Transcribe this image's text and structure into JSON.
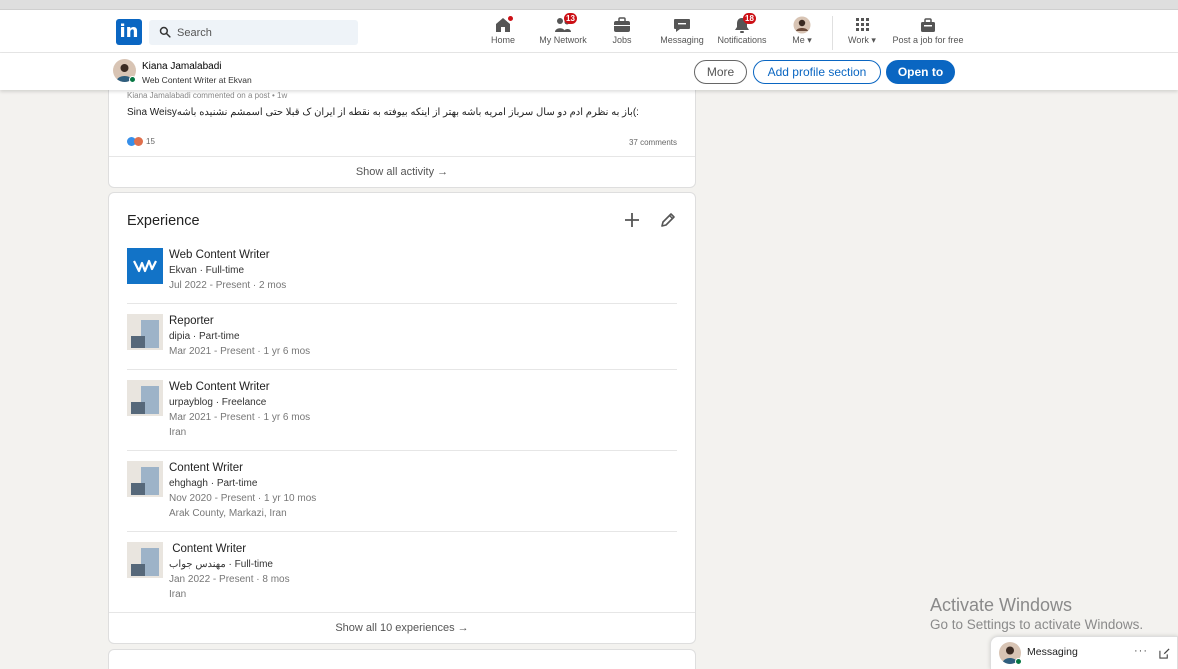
{
  "nav": {
    "search_placeholder": "Search",
    "items": [
      {
        "label": "Home",
        "icon": "home-icon",
        "badge": ""
      },
      {
        "label": "My Network",
        "icon": "people-icon",
        "badge": "13"
      },
      {
        "label": "Jobs",
        "icon": "briefcase-icon",
        "badge": ""
      },
      {
        "label": "Messaging",
        "icon": "chat-icon",
        "badge": ""
      },
      {
        "label": "Notifications",
        "icon": "bell-icon",
        "badge": "18"
      },
      {
        "label": "Me",
        "icon": "avatar",
        "badge": ""
      },
      {
        "label": "Work",
        "icon": "grid-icon",
        "badge": ""
      },
      {
        "label": "Post a job for free",
        "icon": "briefcase-plus-icon",
        "badge": ""
      }
    ],
    "logo_text": "in"
  },
  "profile_bar": {
    "name": "Kiana Jamalabadi",
    "headline": "Web Content Writer at Ekvan",
    "more_label": "More",
    "add_section_label": "Add profile section",
    "open_to_label": "Open to"
  },
  "activity": {
    "meta": "Kiana Jamalabadi commented on a post • 1w",
    "text": "Sina Weisyباز به نظرم ادم دو سال سرباز امریه باشه بهتر از اینکه بیوفته به نقطه از ایران ک قبلا حتی اسمشم نشنیده باشه(:",
    "reactions": "15",
    "comments": "37 comments",
    "footer": "Show all activity →"
  },
  "experience": {
    "title": "Experience",
    "items": [
      {
        "role": "Web Content Writer",
        "company": "Ekvan · Full-time",
        "dates": "Jul 2022 - Present · 2 mos",
        "location": ""
      },
      {
        "role": "Reporter",
        "company": "dipia · Part-time",
        "dates": "Mar 2021 - Present · 1 yr 6 mos",
        "location": ""
      },
      {
        "role": "Web Content Writer",
        "company": "urpayblog · Freelance",
        "dates": "Mar 2021 - Present · 1 yr 6 mos",
        "location": "Iran"
      },
      {
        "role": "Content Writer",
        "company": "ehghagh · Part-time",
        "dates": "Nov 2020 - Present · 1 yr 10 mos",
        "location": "Arak County, Markazi, Iran"
      },
      {
        "role": " Content Writer",
        "company": "مهندس جواب · Full-time",
        "dates": "Jan 2022 - Present · 8 mos",
        "location": "Iran"
      }
    ],
    "footer": "Show all 10 experiences →"
  },
  "watermark": {
    "title": "Activate Windows",
    "subtitle": "Go to Settings to activate Windows."
  },
  "messaging": {
    "label": "Messaging",
    "more": "···"
  },
  "colors": {
    "brand": "#0a66c2",
    "badge": "#cc1016",
    "online": "#057642"
  }
}
